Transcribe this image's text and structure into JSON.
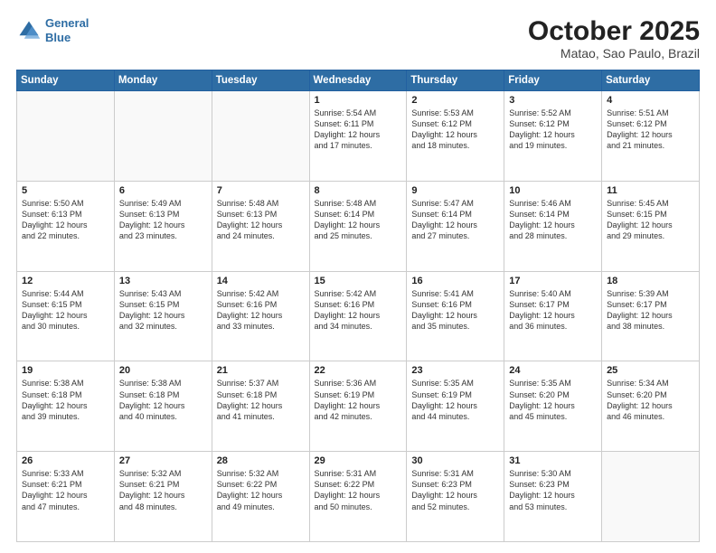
{
  "header": {
    "logo_line1": "General",
    "logo_line2": "Blue",
    "title": "October 2025",
    "subtitle": "Matao, Sao Paulo, Brazil"
  },
  "weekdays": [
    "Sunday",
    "Monday",
    "Tuesday",
    "Wednesday",
    "Thursday",
    "Friday",
    "Saturday"
  ],
  "weeks": [
    [
      {
        "day": "",
        "info": ""
      },
      {
        "day": "",
        "info": ""
      },
      {
        "day": "",
        "info": ""
      },
      {
        "day": "1",
        "info": "Sunrise: 5:54 AM\nSunset: 6:11 PM\nDaylight: 12 hours\nand 17 minutes."
      },
      {
        "day": "2",
        "info": "Sunrise: 5:53 AM\nSunset: 6:12 PM\nDaylight: 12 hours\nand 18 minutes."
      },
      {
        "day": "3",
        "info": "Sunrise: 5:52 AM\nSunset: 6:12 PM\nDaylight: 12 hours\nand 19 minutes."
      },
      {
        "day": "4",
        "info": "Sunrise: 5:51 AM\nSunset: 6:12 PM\nDaylight: 12 hours\nand 21 minutes."
      }
    ],
    [
      {
        "day": "5",
        "info": "Sunrise: 5:50 AM\nSunset: 6:13 PM\nDaylight: 12 hours\nand 22 minutes."
      },
      {
        "day": "6",
        "info": "Sunrise: 5:49 AM\nSunset: 6:13 PM\nDaylight: 12 hours\nand 23 minutes."
      },
      {
        "day": "7",
        "info": "Sunrise: 5:48 AM\nSunset: 6:13 PM\nDaylight: 12 hours\nand 24 minutes."
      },
      {
        "day": "8",
        "info": "Sunrise: 5:48 AM\nSunset: 6:14 PM\nDaylight: 12 hours\nand 25 minutes."
      },
      {
        "day": "9",
        "info": "Sunrise: 5:47 AM\nSunset: 6:14 PM\nDaylight: 12 hours\nand 27 minutes."
      },
      {
        "day": "10",
        "info": "Sunrise: 5:46 AM\nSunset: 6:14 PM\nDaylight: 12 hours\nand 28 minutes."
      },
      {
        "day": "11",
        "info": "Sunrise: 5:45 AM\nSunset: 6:15 PM\nDaylight: 12 hours\nand 29 minutes."
      }
    ],
    [
      {
        "day": "12",
        "info": "Sunrise: 5:44 AM\nSunset: 6:15 PM\nDaylight: 12 hours\nand 30 minutes."
      },
      {
        "day": "13",
        "info": "Sunrise: 5:43 AM\nSunset: 6:15 PM\nDaylight: 12 hours\nand 32 minutes."
      },
      {
        "day": "14",
        "info": "Sunrise: 5:42 AM\nSunset: 6:16 PM\nDaylight: 12 hours\nand 33 minutes."
      },
      {
        "day": "15",
        "info": "Sunrise: 5:42 AM\nSunset: 6:16 PM\nDaylight: 12 hours\nand 34 minutes."
      },
      {
        "day": "16",
        "info": "Sunrise: 5:41 AM\nSunset: 6:16 PM\nDaylight: 12 hours\nand 35 minutes."
      },
      {
        "day": "17",
        "info": "Sunrise: 5:40 AM\nSunset: 6:17 PM\nDaylight: 12 hours\nand 36 minutes."
      },
      {
        "day": "18",
        "info": "Sunrise: 5:39 AM\nSunset: 6:17 PM\nDaylight: 12 hours\nand 38 minutes."
      }
    ],
    [
      {
        "day": "19",
        "info": "Sunrise: 5:38 AM\nSunset: 6:18 PM\nDaylight: 12 hours\nand 39 minutes."
      },
      {
        "day": "20",
        "info": "Sunrise: 5:38 AM\nSunset: 6:18 PM\nDaylight: 12 hours\nand 40 minutes."
      },
      {
        "day": "21",
        "info": "Sunrise: 5:37 AM\nSunset: 6:18 PM\nDaylight: 12 hours\nand 41 minutes."
      },
      {
        "day": "22",
        "info": "Sunrise: 5:36 AM\nSunset: 6:19 PM\nDaylight: 12 hours\nand 42 minutes."
      },
      {
        "day": "23",
        "info": "Sunrise: 5:35 AM\nSunset: 6:19 PM\nDaylight: 12 hours\nand 44 minutes."
      },
      {
        "day": "24",
        "info": "Sunrise: 5:35 AM\nSunset: 6:20 PM\nDaylight: 12 hours\nand 45 minutes."
      },
      {
        "day": "25",
        "info": "Sunrise: 5:34 AM\nSunset: 6:20 PM\nDaylight: 12 hours\nand 46 minutes."
      }
    ],
    [
      {
        "day": "26",
        "info": "Sunrise: 5:33 AM\nSunset: 6:21 PM\nDaylight: 12 hours\nand 47 minutes."
      },
      {
        "day": "27",
        "info": "Sunrise: 5:32 AM\nSunset: 6:21 PM\nDaylight: 12 hours\nand 48 minutes."
      },
      {
        "day": "28",
        "info": "Sunrise: 5:32 AM\nSunset: 6:22 PM\nDaylight: 12 hours\nand 49 minutes."
      },
      {
        "day": "29",
        "info": "Sunrise: 5:31 AM\nSunset: 6:22 PM\nDaylight: 12 hours\nand 50 minutes."
      },
      {
        "day": "30",
        "info": "Sunrise: 5:31 AM\nSunset: 6:23 PM\nDaylight: 12 hours\nand 52 minutes."
      },
      {
        "day": "31",
        "info": "Sunrise: 5:30 AM\nSunset: 6:23 PM\nDaylight: 12 hours\nand 53 minutes."
      },
      {
        "day": "",
        "info": ""
      }
    ]
  ]
}
